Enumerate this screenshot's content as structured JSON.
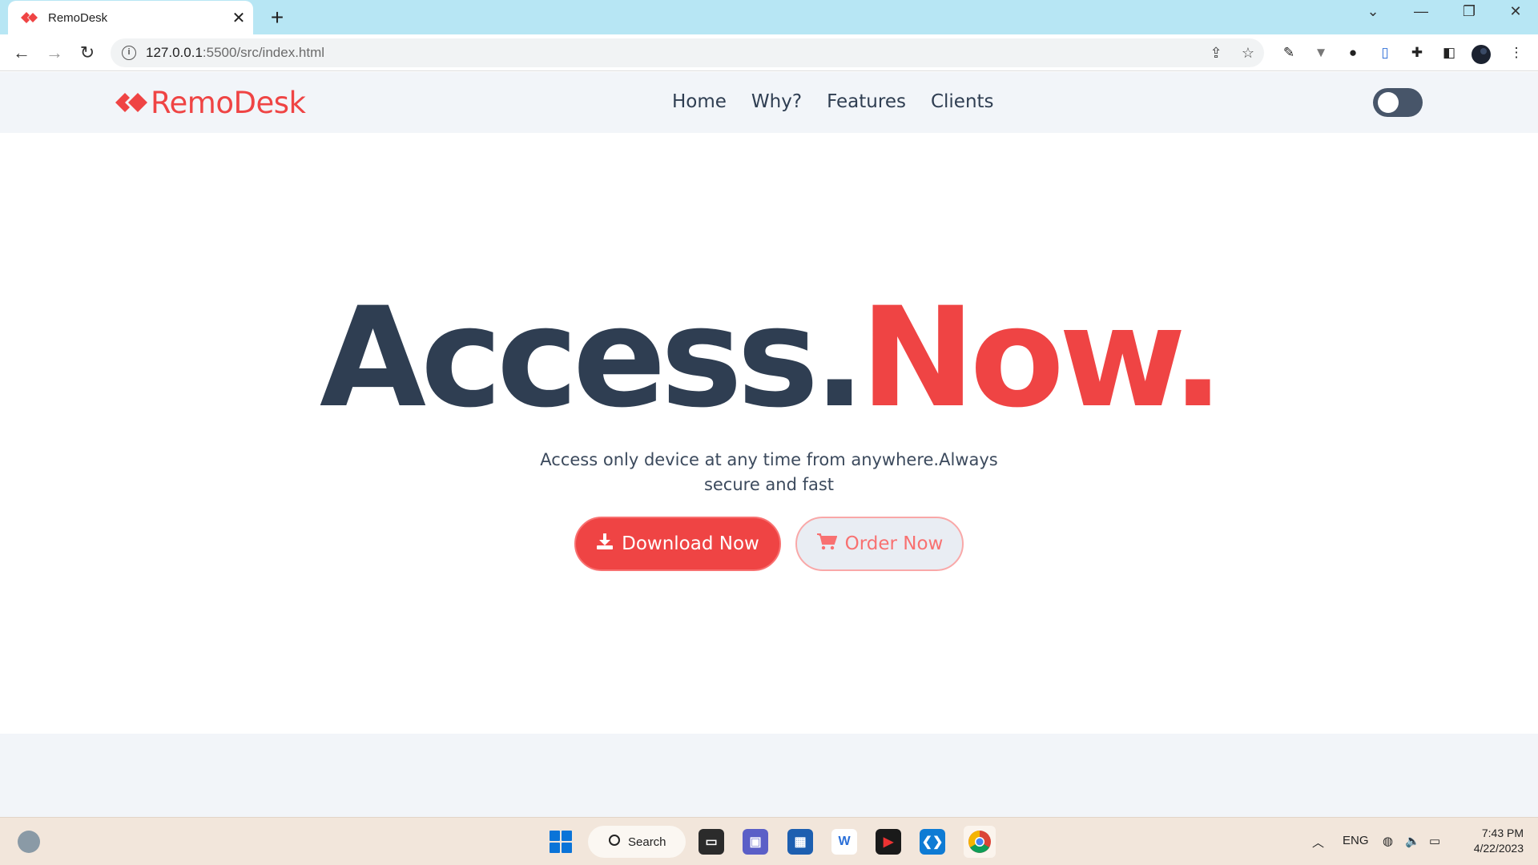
{
  "browser": {
    "tab_title": "RemoDesk",
    "url_host": "127.0.0.1",
    "url_path": ":5500/src/index.html"
  },
  "site": {
    "brand": "RemoDesk",
    "accent_color": "#ef4444",
    "nav": [
      "Home",
      "Why?",
      "Features",
      "Clients"
    ],
    "theme_toggle_on": false
  },
  "hero": {
    "headline_dark": "Access.",
    "headline_red": "Now.",
    "subtitle": "Access only device at any time from anywhere.Always secure and fast",
    "primary_button": "Download Now",
    "secondary_button": "Order Now"
  },
  "taskbar": {
    "search_label": "Search",
    "language": "ENG",
    "time": "7:43 PM",
    "date": "4/22/2023"
  }
}
